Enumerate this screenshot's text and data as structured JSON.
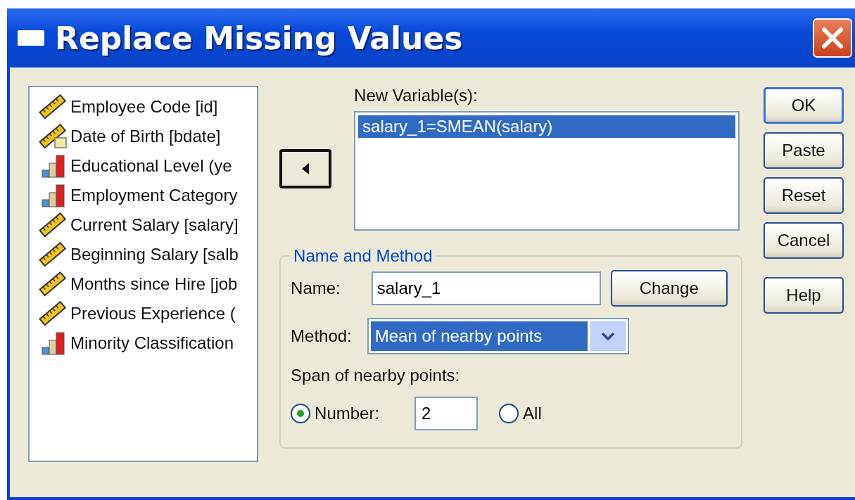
{
  "window": {
    "title": "Replace Missing Values"
  },
  "variables": [
    {
      "label": "Employee Code [id]",
      "kind": "scale"
    },
    {
      "label": "Date of Birth [bdate]",
      "kind": "date"
    },
    {
      "label": "Educational Level (ye",
      "kind": "ordinal"
    },
    {
      "label": "Employment Category",
      "kind": "ordinal"
    },
    {
      "label": "Current Salary [salary]",
      "kind": "scale"
    },
    {
      "label": "Beginning Salary [salb",
      "kind": "scale"
    },
    {
      "label": "Months since Hire [job",
      "kind": "scale"
    },
    {
      "label": "Previous Experience (",
      "kind": "scale"
    },
    {
      "label": "Minority Classification",
      "kind": "ordinal"
    }
  ],
  "new_variables": {
    "label": "New Variable(s):",
    "items": [
      {
        "text": "salary_1=SMEAN(salary)",
        "selected": true
      }
    ]
  },
  "name_and_method": {
    "title": "Name and Method",
    "name_label": "Name:",
    "name_value": "salary_1",
    "change_button": "Change",
    "method_label": "Method:",
    "method_value": "Mean of nearby points",
    "span_label": "Span of nearby points:",
    "options": [
      {
        "label": "Number:",
        "selected": true,
        "value": "2"
      },
      {
        "label": "All",
        "selected": false
      }
    ]
  },
  "buttons": [
    {
      "label": "OK",
      "default": true
    },
    {
      "label": "Paste",
      "default": false
    },
    {
      "label": "Reset",
      "default": false
    },
    {
      "label": "Cancel",
      "default": false
    },
    {
      "label": "Help",
      "default": false
    }
  ]
}
